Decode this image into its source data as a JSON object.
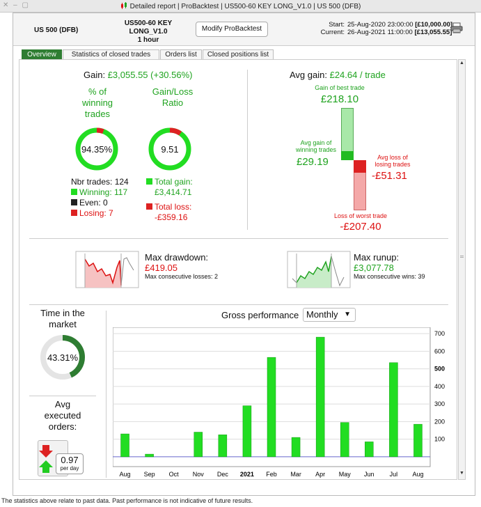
{
  "window": {
    "title": "Detailed report | ProBacktest | US500-60 KEY LONG_V1.0 | US 500 (DFB)"
  },
  "header": {
    "instrument": "US 500 (DFB)",
    "strategy_line1": "US500-60 KEY LONG_V1.0",
    "strategy_line2": "1 hour",
    "modify_button": "Modify ProBacktest",
    "start_label": "Start:",
    "start_value": "25-Aug-2020 23:00:00",
    "start_capital": "[£10,000.00]",
    "current_label": "Current:",
    "current_value": "26-Aug-2021 11:00:00",
    "current_capital": "[£13,055.55]"
  },
  "tabs": [
    "Overview",
    "Statistics of closed trades",
    "Orders list",
    "Closed positions list"
  ],
  "gain": {
    "label": "Gain:",
    "value": "£3,055.55 (+30.56%)"
  },
  "winning": {
    "title_l1": "% of",
    "title_l2": "winning",
    "title_l3": "trades",
    "percent": "94.35%",
    "fraction": 0.9435
  },
  "ratio": {
    "title_l1": "Gain/Loss",
    "title_l2": "Ratio",
    "value": "9.51"
  },
  "trades": {
    "nbr_label": "Nbr trades: 124",
    "winning": "Winning: 117",
    "even": "Even: 0",
    "losing": "Losing: 7",
    "total_gain_label": "Total gain:",
    "total_gain": "£3,414.71",
    "total_loss_label": "Total loss:",
    "total_loss": "-£359.16"
  },
  "avg": {
    "label": "Avg gain:",
    "value": "£24.64 / trade",
    "best_label": "Gain of best trade",
    "best": "£218.10",
    "avg_win_label_l1": "Avg gain of",
    "avg_win_label_l2": "winning trades",
    "avg_win": "£29.19",
    "avg_loss_label_l1": "Avg loss of",
    "avg_loss_label_l2": "losing trades",
    "avg_loss": "-£51.31",
    "worst_label": "Loss of worst trade",
    "worst": "-£207.40"
  },
  "drawdown": {
    "label": "Max drawdown:",
    "value": "£419.05",
    "sub": "Max consecutive losses: 2"
  },
  "runup": {
    "label": "Max runup:",
    "value": "£3,077.78",
    "sub": "Max consecutive wins: 39"
  },
  "market": {
    "title_l1": "Time in the",
    "title_l2": "market",
    "percent": "43.31%",
    "fraction": 0.4331
  },
  "orders": {
    "title_l1": "Avg",
    "title_l2": "executed",
    "title_l3": "orders:",
    "value": "0.97",
    "unit": "per day"
  },
  "performance": {
    "title": "Gross performance",
    "period": "Monthly"
  },
  "footer": "The statistics above relate to past data. Past performance is not indicative of future results.",
  "chart_data": {
    "type": "bar",
    "title": "Gross performance",
    "categories": [
      "Aug",
      "Sep",
      "Oct",
      "Nov",
      "Dec",
      "2021",
      "Feb",
      "Mar",
      "Apr",
      "May",
      "Jun",
      "Jul",
      "Aug"
    ],
    "values": [
      130,
      15,
      0,
      140,
      125,
      290,
      565,
      110,
      680,
      195,
      85,
      535,
      185
    ],
    "y_ticks": [
      100,
      200,
      300,
      400,
      500,
      600,
      700
    ],
    "ylim": [
      -40,
      720
    ],
    "color": "#22dd22",
    "grid": true
  },
  "colors": {
    "green": "#1fa31f",
    "red": "#dd1111",
    "dark_green": "#2e7d32",
    "bar_green": "#22dd22"
  }
}
